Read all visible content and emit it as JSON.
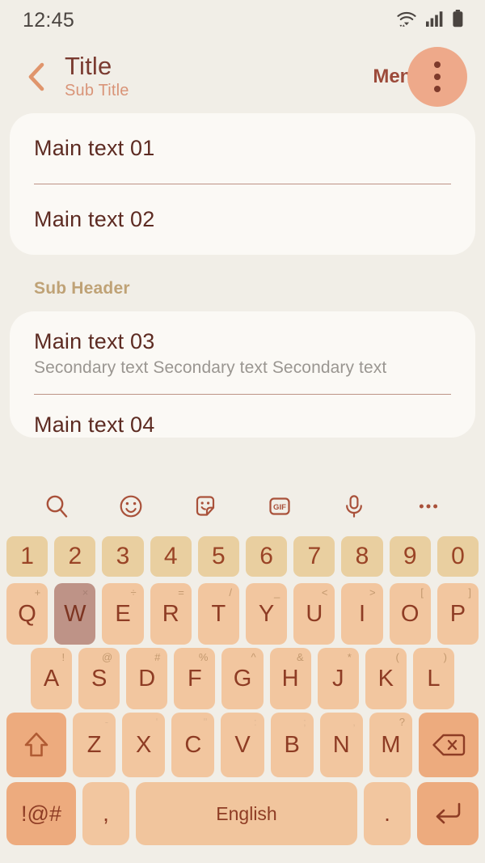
{
  "status_bar": {
    "time": "12:45",
    "icons": [
      "wifi-icon",
      "cellular-signal-icon",
      "battery-icon"
    ]
  },
  "app_bar": {
    "back_icon": "chevron-left-icon",
    "title": "Title",
    "subtitle": "Sub Title",
    "menu_label": "Menu",
    "overflow_icon": "more-vertical-icon"
  },
  "content": {
    "card_one": {
      "rows": [
        {
          "main": "Main text 01"
        },
        {
          "main": "Main text 02"
        }
      ]
    },
    "sub_header": "Sub Header",
    "card_two": {
      "rows": [
        {
          "main": "Main text 03",
          "secondary": "Secondary text Secondary text Secondary text"
        },
        {
          "main": "Main text 04"
        }
      ]
    }
  },
  "keyboard": {
    "toolbar": [
      {
        "name": "search-icon",
        "label": "search"
      },
      {
        "name": "emoji-icon",
        "label": "emoji"
      },
      {
        "name": "sticker-icon",
        "label": "sticker"
      },
      {
        "name": "gif-icon",
        "label": "GIF"
      },
      {
        "name": "microphone-icon",
        "label": "voice input"
      },
      {
        "name": "more-horizontal-icon",
        "label": "more"
      }
    ],
    "rows": {
      "numbers": [
        {
          "label": "1"
        },
        {
          "label": "2"
        },
        {
          "label": "3"
        },
        {
          "label": "4"
        },
        {
          "label": "5"
        },
        {
          "label": "6"
        },
        {
          "label": "7"
        },
        {
          "label": "8"
        },
        {
          "label": "9"
        },
        {
          "label": "0"
        }
      ],
      "top": [
        {
          "label": "Q",
          "sup": "+"
        },
        {
          "label": "W",
          "sup": "×",
          "pressed": true
        },
        {
          "label": "E",
          "sup": "÷"
        },
        {
          "label": "R",
          "sup": "="
        },
        {
          "label": "T",
          "sup": "/"
        },
        {
          "label": "Y",
          "sup": "_"
        },
        {
          "label": "U",
          "sup": "<"
        },
        {
          "label": "I",
          "sup": ">"
        },
        {
          "label": "O",
          "sup": "["
        },
        {
          "label": "P",
          "sup": "]"
        }
      ],
      "home": [
        {
          "label": "A",
          "sup": "!"
        },
        {
          "label": "S",
          "sup": "@"
        },
        {
          "label": "D",
          "sup": "#"
        },
        {
          "label": "F",
          "sup": "%"
        },
        {
          "label": "G",
          "sup": "^"
        },
        {
          "label": "H",
          "sup": "&"
        },
        {
          "label": "J",
          "sup": "*"
        },
        {
          "label": "K",
          "sup": "("
        },
        {
          "label": "L",
          "sup": ")"
        }
      ],
      "bottom_letters": [
        {
          "label": "Z",
          "sup": "-"
        },
        {
          "label": "X",
          "sup": "'"
        },
        {
          "label": "C",
          "sup": "\""
        },
        {
          "label": "V",
          "sup": ":"
        },
        {
          "label": "B",
          "sup": ";"
        },
        {
          "label": "N",
          "sup": ","
        },
        {
          "label": "M",
          "sup": "?"
        }
      ],
      "shift_icon": "shift-arrow-up-icon",
      "backspace_icon": "backspace-icon",
      "symbols_label": "!@#",
      "comma_label": ",",
      "space_label": "English",
      "period_label": ".",
      "enter_icon": "enter-return-icon"
    }
  },
  "colors": {
    "background": "#F1EEE7",
    "card": "#FBF9F5",
    "title": "#7A3B31",
    "subtitle": "#D99478",
    "sub_header": "#BFA276",
    "divider": "#A8705F",
    "secondary_text": "#9A9691",
    "key": "#F2C69F",
    "key_number": "#E9CFA0",
    "key_accent": "#EDAB7E",
    "key_pressed": "#BE9387",
    "key_text": "#8E3C24",
    "overflow_circle": "#EEA98A"
  }
}
